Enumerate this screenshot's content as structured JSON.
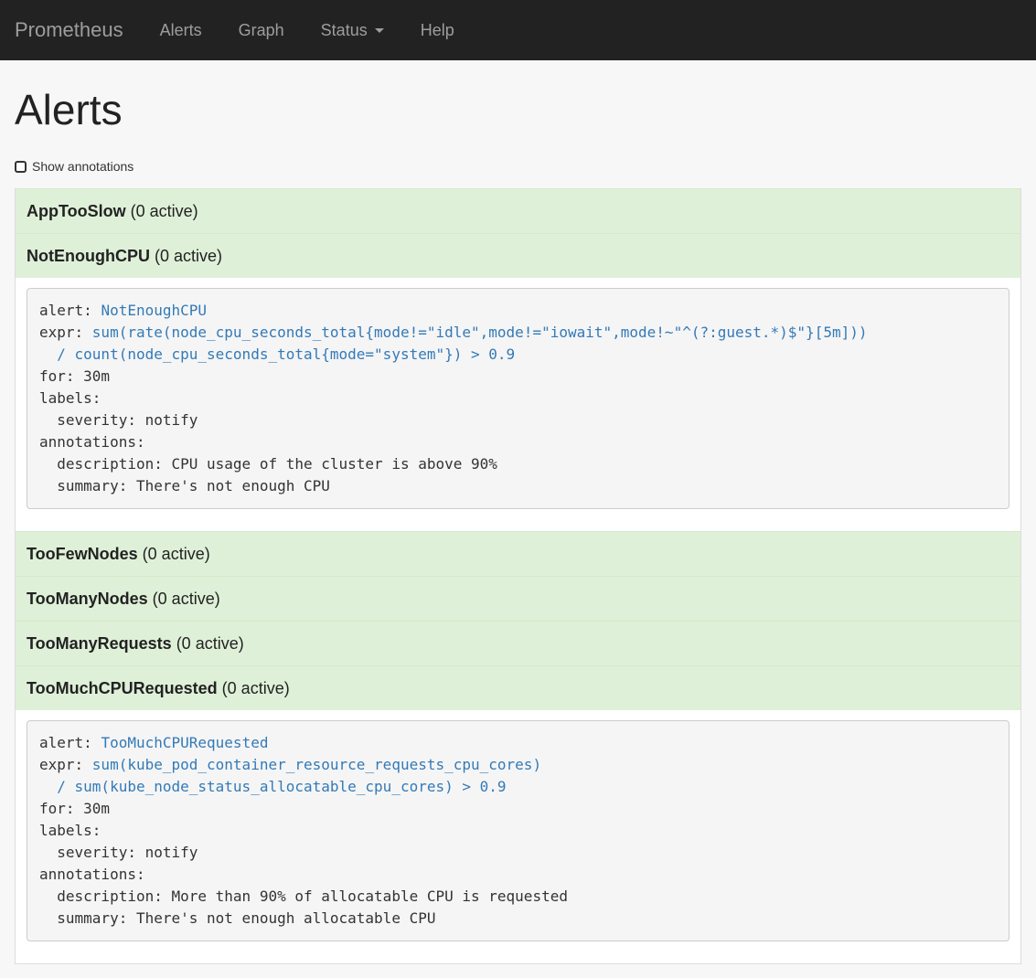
{
  "nav": {
    "brand": "Prometheus",
    "alerts": "Alerts",
    "graph": "Graph",
    "status": "Status",
    "help": "Help"
  },
  "page": {
    "title": "Alerts",
    "show_annotations": "Show annotations"
  },
  "colors": {
    "navbar": "#222222",
    "alert_ok_bg": "#dff0d8",
    "link": "#337ab7"
  },
  "alerts": [
    {
      "name": "AppTooSlow",
      "count": "(0 active)"
    },
    {
      "name": "NotEnoughCPU",
      "count": "(0 active)",
      "rule": {
        "alert_key": "alert: ",
        "alert_value": "NotEnoughCPU",
        "expr_key": "expr: ",
        "expr_line1": "sum(rate(node_cpu_seconds_total{mode!=\"idle\",mode!=\"iowait\",mode!~\"^(?:guest.*)$\"}[5m]))",
        "expr_line2": "  / count(node_cpu_seconds_total{mode=\"system\"}) > 0.9",
        "for": "for: 30m",
        "labels": "labels:",
        "severity": "  severity: notify",
        "annotations": "annotations:",
        "description": "  description: CPU usage of the cluster is above 90%",
        "summary": "  summary: There's not enough CPU"
      }
    },
    {
      "name": "TooFewNodes",
      "count": "(0 active)"
    },
    {
      "name": "TooManyNodes",
      "count": "(0 active)"
    },
    {
      "name": "TooManyRequests",
      "count": "(0 active)"
    },
    {
      "name": "TooMuchCPURequested",
      "count": "(0 active)",
      "rule": {
        "alert_key": "alert: ",
        "alert_value": "TooMuchCPURequested",
        "expr_key": "expr: ",
        "expr_line1": "sum(kube_pod_container_resource_requests_cpu_cores)",
        "expr_line2": "  / sum(kube_node_status_allocatable_cpu_cores) > 0.9",
        "for": "for: 30m",
        "labels": "labels:",
        "severity": "  severity: notify",
        "annotations": "annotations:",
        "description": "  description: More than 90% of allocatable CPU is requested",
        "summary": "  summary: There's not enough allocatable CPU"
      }
    }
  ]
}
